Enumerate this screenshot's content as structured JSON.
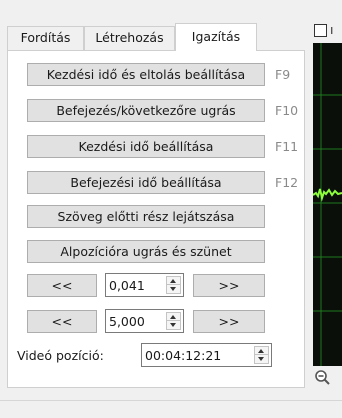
{
  "tabs": [
    {
      "label": "Fordítás",
      "active": false
    },
    {
      "label": "Létrehozás",
      "active": false
    },
    {
      "label": "Igazítás",
      "active": true
    }
  ],
  "adjust": {
    "set_start_offset": {
      "label": "Kezdési idő és eltolás beállítása",
      "shortcut": "F9"
    },
    "goto_end_next": {
      "label": "Befejezés/következőre ugrás",
      "shortcut": "F10"
    },
    "set_start": {
      "label": "Kezdési idő beállítása",
      "shortcut": "F11"
    },
    "set_end": {
      "label": "Befejezési idő beállítása",
      "shortcut": "F12"
    },
    "play_before": {
      "label": "Szöveg előtti rész lejátszása"
    },
    "goto_pause": {
      "label": "Alpozícióra ugrás és szünet"
    },
    "step_small": {
      "back": "<<",
      "forward": ">>",
      "value": "0,041"
    },
    "step_large": {
      "back": "<<",
      "forward": ">>",
      "value": "5,000"
    },
    "video_position": {
      "label": "Videó pozíció:",
      "value": "00:04:12:21"
    }
  },
  "waveform": {
    "background": "#0a0f0a",
    "grid_color": "#1f7a1f",
    "signal_color": "#8cff3c"
  },
  "icons": {
    "zoom": "zoom-out-icon",
    "checkbox": "checkbox-icon"
  }
}
